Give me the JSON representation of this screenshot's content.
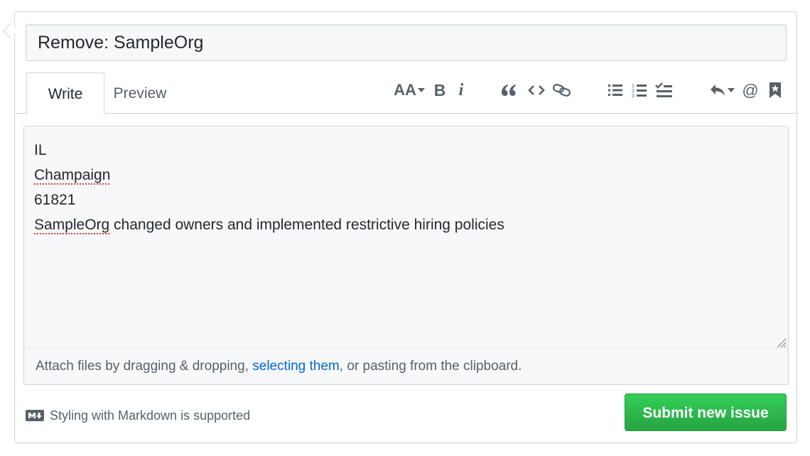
{
  "issue": {
    "title_value": "Remove: SampleOrg",
    "tabs": [
      {
        "label": "Write"
      },
      {
        "label": "Preview"
      }
    ],
    "toolbar": {
      "header_text": "AA",
      "bold": "B",
      "italic": "i"
    },
    "body_lines": [
      "IL",
      "Champaign",
      "61821",
      "SampleOrg",
      " changed owners and implemented restrictive hiring policies"
    ],
    "drop": {
      "prefix": "Attach files by dragging & dropping, ",
      "link": "selecting them",
      "suffix": ", or pasting from the clipboard."
    },
    "markdown_note": "Styling with Markdown is supported",
    "submit_label": "Submit new issue"
  },
  "icons": [
    "text-size-icon",
    "bold-icon",
    "italic-icon",
    "quote-icon",
    "code-icon",
    "link-icon",
    "unordered-list-icon",
    "ordered-list-icon",
    "tasklist-icon",
    "reply-icon",
    "mention-icon",
    "bookmark-icon",
    "resize-handle-icon",
    "markdown-icon"
  ],
  "colors": {
    "accent_link": "#0366d6",
    "submit_green": "#28a745",
    "border": "#d1d5da",
    "spellcheck": "#d73a49"
  }
}
